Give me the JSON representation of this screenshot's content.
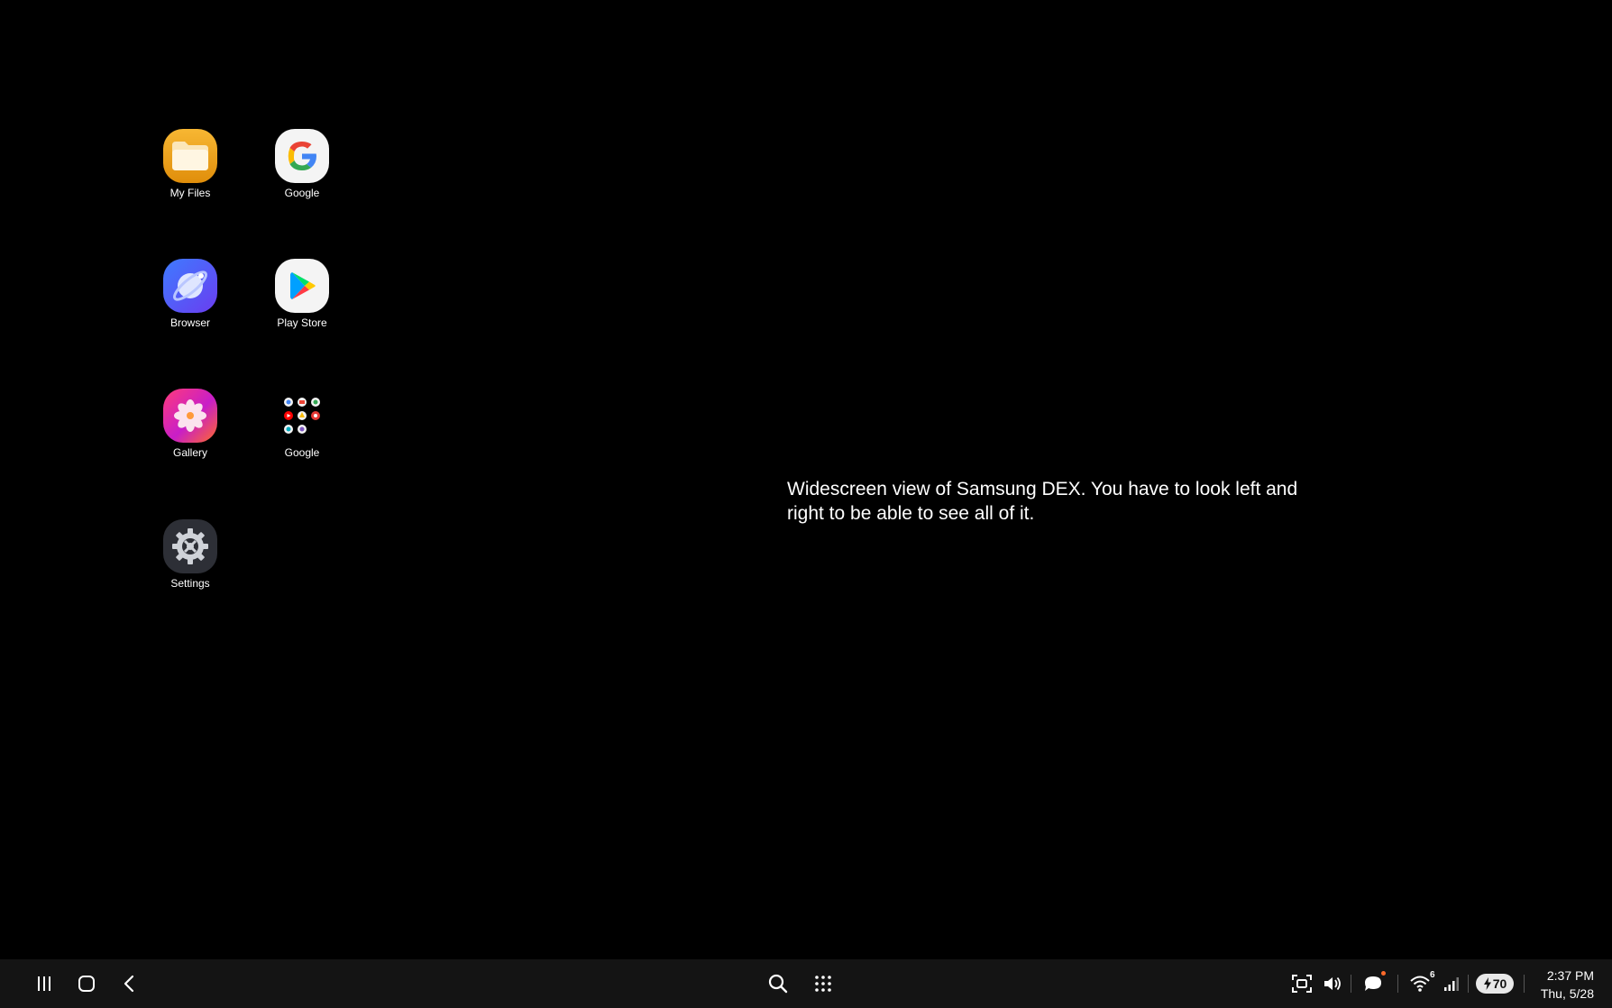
{
  "desktop": {
    "apps": [
      {
        "label": "My Files",
        "icon": "my-files-icon"
      },
      {
        "label": "Google",
        "icon": "google-icon"
      },
      {
        "label": "Browser",
        "icon": "browser-icon"
      },
      {
        "label": "Play Store",
        "icon": "play-store-icon"
      },
      {
        "label": "Gallery",
        "icon": "gallery-icon"
      },
      {
        "label": "Google",
        "icon": "google-folder-icon"
      },
      {
        "label": "Settings",
        "icon": "settings-icon"
      }
    ],
    "overlay_text": "Widescreen view of Samsung DEX. You have to look left and right to be able to see all of it."
  },
  "taskbar": {
    "nav_icons": [
      "recent-apps-icon",
      "home-icon",
      "back-icon"
    ],
    "center_icons": [
      "search-icon",
      "app-drawer-icon"
    ],
    "tray_icons": [
      "screenshot-icon",
      "volume-icon",
      "notification-icon",
      "wifi-icon",
      "signal-icon",
      "battery-icon"
    ],
    "wifi_label": "6",
    "battery_level": "70",
    "time": "2:37 PM",
    "date": "Thu, 5/28",
    "colors": {
      "background": "#141414",
      "notification_dot": "#ff6a2a"
    }
  }
}
